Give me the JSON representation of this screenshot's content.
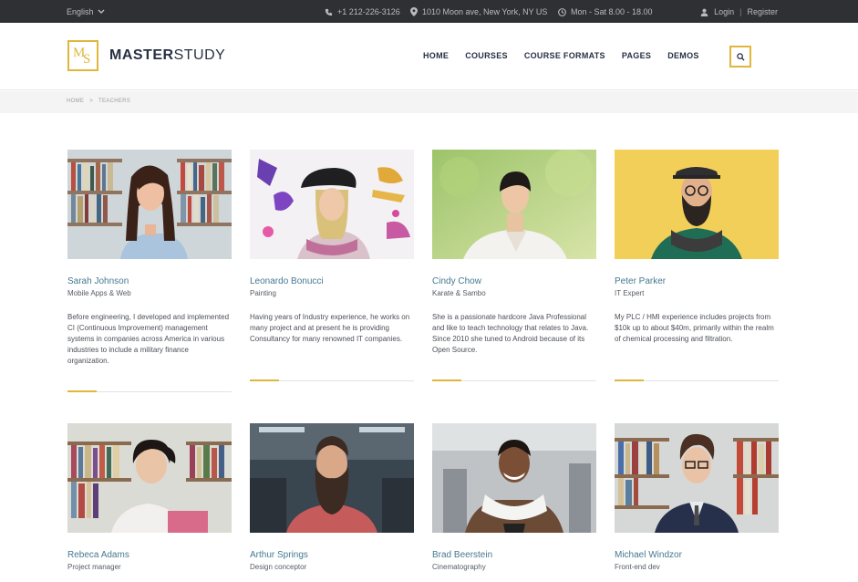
{
  "topbar": {
    "language": "English",
    "phone": "+1 212-226-3126",
    "address": "1010 Moon ave, New York, NY US",
    "hours": "Mon - Sat 8.00 - 18.00",
    "login": "Login",
    "separator": "|",
    "register": "Register"
  },
  "header": {
    "logo_initials_m": "M",
    "logo_initials_s": "S",
    "logo_bold": "MASTER",
    "logo_light": "STUDY",
    "nav": [
      "HOME",
      "COURSES",
      "COURSE FORMATS",
      "PAGES",
      "DEMOS"
    ]
  },
  "breadcrumb": {
    "home": "HOME",
    "separator": ">",
    "current": "TEACHERS"
  },
  "teachers": [
    {
      "name": "Sarah Johnson",
      "role": "Mobile Apps & Web",
      "bio": "Before engineering, I developed and implemented CI (Continuous Improvement) management systems in companies across America in various industries to include a military finance organization."
    },
    {
      "name": "Leonardo Bonucci",
      "role": "Painting",
      "bio": "Having years of Industry experience, he works on many project and at present he is providing Consultancy for many renowned IT companies."
    },
    {
      "name": "Cindy Chow",
      "role": "Karate & Sambo",
      "bio": "She is a passionate hardcore Java Professional and like to teach technology that relates to Java. Since 2010 she tuned to Android because of its Open Source."
    },
    {
      "name": "Peter Parker",
      "role": "IT Expert",
      "bio": "My PLC / HMI experience includes projects from $10k up to about $40m, primarily within the realm of chemical processing and filtration."
    },
    {
      "name": "Rebeca Adams",
      "role": "Project manager",
      "bio": ""
    },
    {
      "name": "Arthur Springs",
      "role": "Design conceptor",
      "bio": ""
    },
    {
      "name": "Brad Beerstein",
      "role": "Cinematography",
      "bio": ""
    },
    {
      "name": "Michael Windzor",
      "role": "Front-end dev",
      "bio": ""
    }
  ],
  "colors": {
    "accent": "#e0b63c",
    "topbar": "#2f3033",
    "name_link": "#457992",
    "navy": "#273044"
  }
}
